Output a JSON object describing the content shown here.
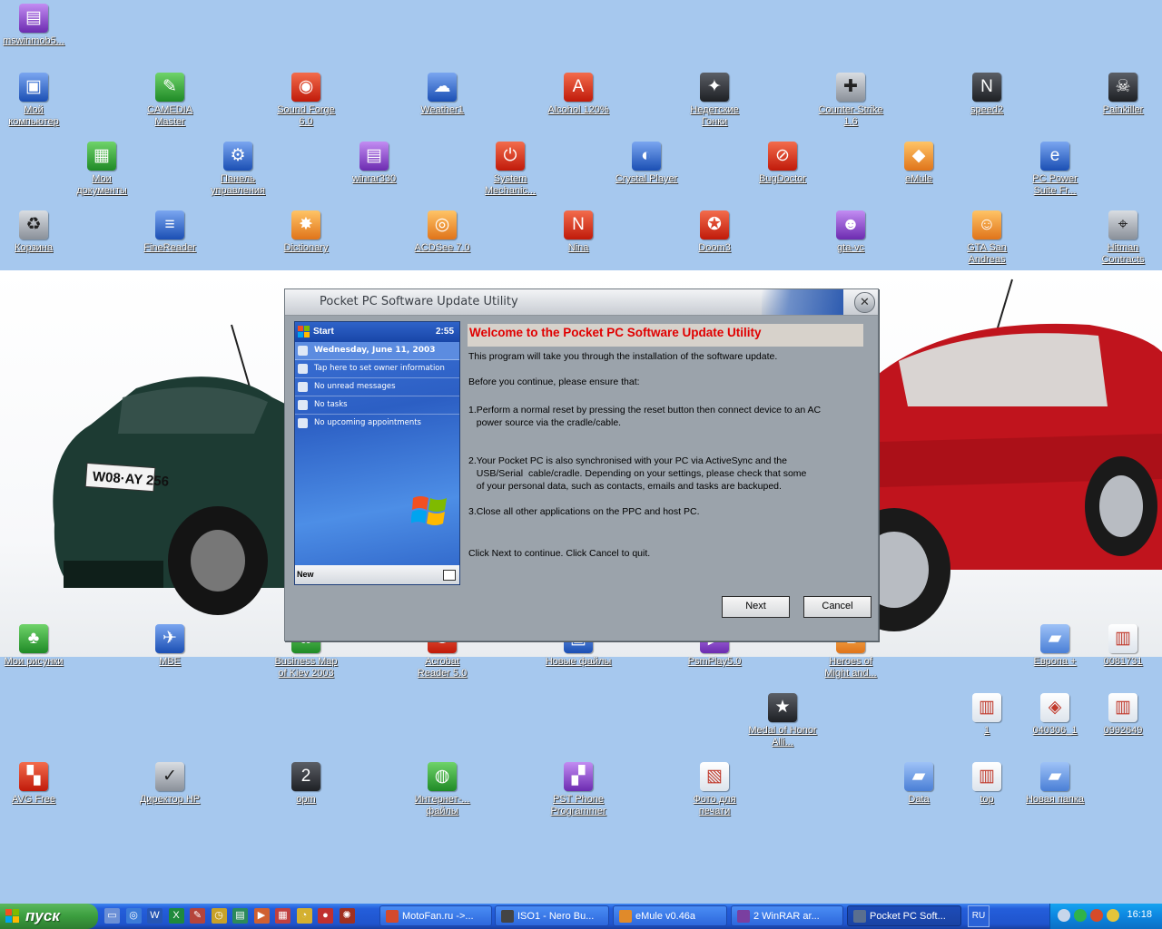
{
  "desktop": {
    "icons": [
      {
        "label": "mswinmob5...",
        "glyph": "▤",
        "color": "g-purple"
      },
      {
        "label": "Мой компьютер",
        "glyph": "▣",
        "color": "g-blue"
      },
      {
        "label": "CAMEDIA Master",
        "glyph": "✎",
        "color": "g-green"
      },
      {
        "label": "Sound Forge 6.0",
        "glyph": "◉",
        "color": "g-red"
      },
      {
        "label": "Weather1",
        "glyph": "☁",
        "color": "g-blue"
      },
      {
        "label": "Alcohol 120%",
        "glyph": "A",
        "color": "g-red"
      },
      {
        "label": "Недетские Гонки",
        "glyph": "✦",
        "color": "g-dark"
      },
      {
        "label": "Counter-Strike 1.6",
        "glyph": "✚",
        "color": "g-grey"
      },
      {
        "label": "speed2",
        "glyph": "N",
        "color": "g-dark"
      },
      {
        "label": "Painkiller",
        "glyph": "☠",
        "color": "g-dark"
      },
      {
        "label": "Мои документы",
        "glyph": "▦",
        "color": "g-green"
      },
      {
        "label": "Панель управления",
        "glyph": "⚙",
        "color": "g-blue"
      },
      {
        "label": "winrar330",
        "glyph": "▤",
        "color": "g-purple"
      },
      {
        "label": "System Mechanic...",
        "glyph": "⏻",
        "color": "g-red"
      },
      {
        "label": "Crystal Player",
        "glyph": "◐",
        "color": "g-blue"
      },
      {
        "label": "BugDoctor",
        "glyph": "⊘",
        "color": "g-red"
      },
      {
        "label": "eMule",
        "glyph": "◆",
        "color": "g-orange"
      },
      {
        "label": "PC Power Suite Fr...",
        "glyph": "e",
        "color": "g-blue"
      },
      {
        "label": "Корзина",
        "glyph": "♻",
        "color": "g-grey"
      },
      {
        "label": "FineReader",
        "glyph": "≡",
        "color": "g-blue"
      },
      {
        "label": "Dictionary",
        "glyph": "✸",
        "color": "g-orange"
      },
      {
        "label": "ACDSee 7.0",
        "glyph": "◎",
        "color": "g-orange"
      },
      {
        "label": "Nina",
        "glyph": "N",
        "color": "g-red"
      },
      {
        "label": "Doom3",
        "glyph": "✪",
        "color": "g-red"
      },
      {
        "label": "gta-vc",
        "glyph": "☻",
        "color": "g-purple"
      },
      {
        "label": "GTA San Andreas",
        "glyph": "☺",
        "color": "g-orange"
      },
      {
        "label": "Hitman Contracts",
        "glyph": "⌖",
        "color": "g-grey"
      },
      {
        "label": "Мои рисунки",
        "glyph": "♣",
        "color": "g-green"
      },
      {
        "label": "MBE",
        "glyph": "✈",
        "color": "g-blue"
      },
      {
        "label": "Business Map of Kiev 2003",
        "glyph": "✿",
        "color": "g-green"
      },
      {
        "label": "Acrobat Reader 5.0",
        "glyph": "♠",
        "color": "g-red"
      },
      {
        "label": "Новые файлы",
        "glyph": "▣",
        "color": "g-blue"
      },
      {
        "label": "PsmPlay5.0",
        "glyph": "▶",
        "color": "g-purple"
      },
      {
        "label": "Heroes of Might and...",
        "glyph": "♞",
        "color": "g-orange"
      },
      {
        "label": "Европа +",
        "glyph": "▰",
        "color": "g-folder"
      },
      {
        "label": "0081731",
        "glyph": "▥",
        "color": "g-doc"
      },
      {
        "label": "Medal of Honor Alli...",
        "glyph": "★",
        "color": "g-dark"
      },
      {
        "label": "1",
        "glyph": "▥",
        "color": "g-doc"
      },
      {
        "label": "040306_1",
        "glyph": "◈",
        "color": "g-doc"
      },
      {
        "label": "0992649",
        "glyph": "▥",
        "color": "g-doc"
      },
      {
        "label": "AVG Free",
        "glyph": "▚",
        "color": "g-red"
      },
      {
        "label": "Директор HP",
        "glyph": "✓",
        "color": "g-grey"
      },
      {
        "label": "opm",
        "glyph": "2",
        "color": "g-dark"
      },
      {
        "label": "Интернет-... файлы",
        "glyph": "◍",
        "color": "g-green"
      },
      {
        "label": "PST Phone Programmer",
        "glyph": "▞",
        "color": "g-purple"
      },
      {
        "label": "Фото для печати",
        "glyph": "▧",
        "color": "g-doc"
      },
      {
        "label": "Data",
        "glyph": "▰",
        "color": "g-folder"
      },
      {
        "label": "top",
        "glyph": "▥",
        "color": "g-doc"
      },
      {
        "label": "Новая папка",
        "glyph": "▰",
        "color": "g-folder"
      }
    ]
  },
  "dialog": {
    "title": "Pocket PC Software Update Utility",
    "close_symbol": "✕",
    "heading": "Welcome to the Pocket PC Software Update Utility",
    "paragraphs": [
      "This program will take you through the installation of the software update.",
      "Before you continue, please ensure that:",
      "1.Perform a normal reset by pressing the reset button then connect device to an AC\n   power source via the cradle/cable.",
      "2.Your Pocket PC is also synchronised with your PC via ActiveSync and the\n   USB/Serial  cable/cradle. Depending on your settings, please check that some\n   of your personal data, such as contacts, emails and tasks are backuped.",
      "3.Close all other applications on the PPC and host PC.",
      "Click Next to continue. Click Cancel to quit."
    ],
    "next_label": "Next",
    "cancel_label": "Cancel",
    "pocketpc": {
      "start_label": "Start",
      "time": "2:55",
      "date": "Wednesday, June 11, 2003",
      "rows": [
        "Tap here to set owner information",
        "No unread messages",
        "No tasks",
        "No upcoming appointments"
      ],
      "new_label": "New"
    }
  },
  "taskbar": {
    "start_label": "пуск",
    "quicklaunch": [
      {
        "glyph": "▭",
        "color": "#6b8fd6"
      },
      {
        "glyph": "◎",
        "color": "#3b7bd8"
      },
      {
        "glyph": "W",
        "color": "#2656b5"
      },
      {
        "glyph": "X",
        "color": "#1e8a3c"
      },
      {
        "glyph": "✎",
        "color": "#b5443b"
      },
      {
        "glyph": "◷",
        "color": "#c8a228"
      },
      {
        "glyph": "▤",
        "color": "#2c8a5a"
      },
      {
        "glyph": "▶",
        "color": "#d06030"
      },
      {
        "glyph": "▦",
        "color": "#c04040"
      },
      {
        "glyph": "◔",
        "color": "#d4b030"
      },
      {
        "glyph": "●",
        "color": "#c03030"
      },
      {
        "glyph": "✺",
        "color": "#a03020"
      }
    ],
    "tasks": [
      {
        "label": "MotoFan.ru ->...",
        "color": "#d34a2b"
      },
      {
        "label": "ISO1 - Nero Bu...",
        "color": "#444"
      },
      {
        "label": "eMule v0.46a",
        "color": "#e08a2a"
      },
      {
        "label": "2 WinRAR ar...",
        "color": "#7a3fa0"
      },
      {
        "label": "Pocket PC Soft...",
        "color": "#5a6f8f"
      }
    ],
    "language": "RU",
    "clock": "16:18"
  }
}
